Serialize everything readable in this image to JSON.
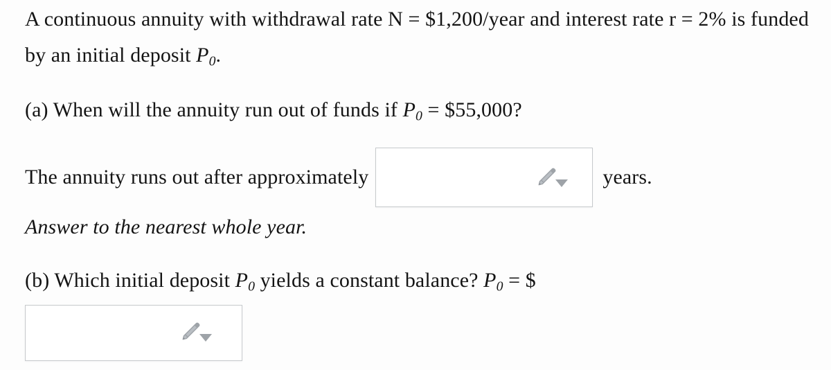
{
  "problem": {
    "intro": {
      "text_part1": "A continuous annuity with withdrawal rate N = $1,200/year and interest rate r = 2% is funded by an initial deposit ",
      "symbol_base": "P",
      "symbol_sub": "0",
      "text_part2": "."
    },
    "part_a": {
      "label": "(a) When will the annuity run out of funds if ",
      "symbol_base": "P",
      "symbol_sub": "0",
      "condition": " = $55,000?"
    },
    "answer_a": {
      "prefix": "The annuity runs out after approximately",
      "suffix": "years.",
      "input_value": "",
      "input_placeholder": "",
      "tool_icon": "pencil-icon",
      "dropdown_icon": "caret-down-icon"
    },
    "hint_a": "Answer to the nearest whole year.",
    "part_b": {
      "label": "(b) Which initial deposit ",
      "symbol_base": "P",
      "symbol_sub": "0",
      "middle": " yields a constant balance? ",
      "symbol_base2": "P",
      "symbol_sub2": "0",
      "equals": " = $"
    },
    "answer_b": {
      "input_value": "",
      "input_placeholder": "",
      "tool_icon": "pencil-icon",
      "dropdown_icon": "caret-down-icon"
    }
  },
  "colors": {
    "page_background": "#fdfdfd",
    "text": "#141414",
    "input_border": "#c6c9cc",
    "input_background": "#ffffff",
    "icon_gray": "#9ea3a8"
  }
}
